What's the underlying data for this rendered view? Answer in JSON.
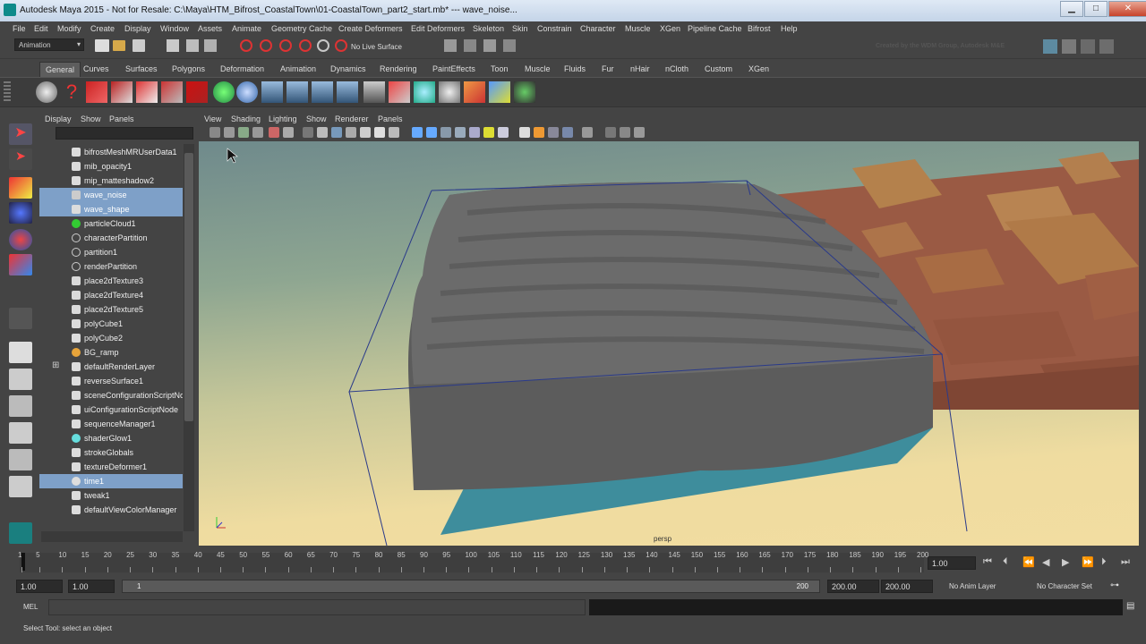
{
  "window": {
    "title": "Autodesk Maya 2015 - Not for Resale: C:\\Maya\\HTM_Bifrost_CoastalTown\\01-CoastalTown_part2_start.mb*  ---  wave_noise...",
    "minimize": "▁",
    "maximize": "□",
    "close": "✕"
  },
  "menubar": [
    "File",
    "Edit",
    "Modify",
    "Create",
    "Display",
    "Window",
    "Assets",
    "Animate",
    "Geometry Cache",
    "Create Deformers",
    "Edit Deformers",
    "Skeleton",
    "Skin",
    "Constrain",
    "Character",
    "Muscle",
    "XGen",
    "Pipeline Cache",
    "Bifrost",
    "Help"
  ],
  "statusline": {
    "menuset": "Animation",
    "live_surface": "No Live Surface",
    "watermark": "Created by the WDM Group, Autodesk M&E"
  },
  "shelf_tabs": [
    "General",
    "Curves",
    "Surfaces",
    "Polygons",
    "Deformation",
    "Animation",
    "Dynamics",
    "Rendering",
    "PaintEffects",
    "Toon",
    "Muscle",
    "Fluids",
    "Fur",
    "nHair",
    "nCloth",
    "Custom",
    "XGen"
  ],
  "outliner": {
    "menu": [
      "Display",
      "Show",
      "Panels"
    ],
    "items": [
      {
        "label": "bifrostMeshMRUserData1",
        "icon": "node",
        "selected": false
      },
      {
        "label": "mib_opacity1",
        "icon": "node",
        "selected": false
      },
      {
        "label": "mip_matteshadow2",
        "icon": "node",
        "selected": false
      },
      {
        "label": "wave_noise",
        "icon": "texture",
        "selected": true
      },
      {
        "label": "wave_shape",
        "icon": "node",
        "selected": true
      },
      {
        "label": "particleCloud1",
        "icon": "green",
        "selected": false
      },
      {
        "label": "characterPartition",
        "icon": "partition",
        "selected": false
      },
      {
        "label": "partition1",
        "icon": "partition",
        "selected": false
      },
      {
        "label": "renderPartition",
        "icon": "partition",
        "selected": false
      },
      {
        "label": "place2dTexture3",
        "icon": "place",
        "selected": false
      },
      {
        "label": "place2dTexture4",
        "icon": "place",
        "selected": false
      },
      {
        "label": "place2dTexture5",
        "icon": "place",
        "selected": false
      },
      {
        "label": "polyCube1",
        "icon": "node",
        "selected": false
      },
      {
        "label": "polyCube2",
        "icon": "node",
        "selected": false
      },
      {
        "label": "BG_ramp",
        "icon": "ramp",
        "selected": false
      },
      {
        "label": "defaultRenderLayer",
        "icon": "node",
        "selected": false
      },
      {
        "label": "reverseSurface1",
        "icon": "node",
        "selected": false
      },
      {
        "label": "sceneConfigurationScriptNode",
        "icon": "node",
        "selected": false
      },
      {
        "label": "uiConfigurationScriptNode",
        "icon": "node",
        "selected": false
      },
      {
        "label": "sequenceManager1",
        "icon": "node",
        "selected": false
      },
      {
        "label": "shaderGlow1",
        "icon": "glow",
        "selected": false
      },
      {
        "label": "strokeGlobals",
        "icon": "node",
        "selected": false
      },
      {
        "label": "textureDeformer1",
        "icon": "node",
        "selected": false
      },
      {
        "label": "time1",
        "icon": "time",
        "selected": true
      },
      {
        "label": "tweak1",
        "icon": "node",
        "selected": false
      },
      {
        "label": "defaultViewColorManager",
        "icon": "node",
        "selected": false
      }
    ]
  },
  "viewport": {
    "menu": [
      "View",
      "Shading",
      "Lighting",
      "Show",
      "Renderer",
      "Panels"
    ],
    "camera": "persp"
  },
  "timeline": {
    "ticks": [
      "1",
      "5",
      "10",
      "15",
      "20",
      "25",
      "30",
      "35",
      "40",
      "45",
      "50",
      "55",
      "60",
      "65",
      "70",
      "75",
      "80",
      "85",
      "90",
      "95",
      "100",
      "105",
      "110",
      "115",
      "120",
      "125",
      "130",
      "135",
      "140",
      "145",
      "150",
      "155",
      "160",
      "165",
      "170",
      "175",
      "180",
      "185",
      "190",
      "195",
      "200"
    ],
    "current_frame": "1.00"
  },
  "range": {
    "start": "1.00",
    "playback_start": "1.00",
    "slider_start": "1",
    "slider_end": "200",
    "playback_end": "200.00",
    "end": "200.00",
    "anim_layer": "No Anim Layer",
    "character_set": "No Character Set"
  },
  "command_line": {
    "label": "MEL"
  },
  "help_line": "Select Tool: select an object"
}
